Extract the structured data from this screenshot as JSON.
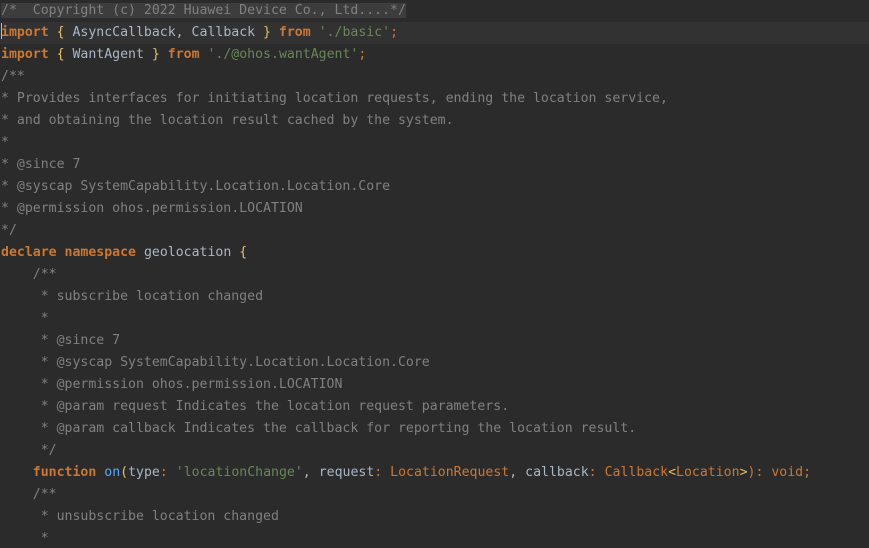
{
  "editor": {
    "header_comment": "/*  Copyright (c) 2022 Huawei Device Co., Ltd....*/",
    "imports": [
      {
        "kw": "import",
        "open": " { ",
        "names": "AsyncCallback, Callback",
        "close": " } ",
        "from": "from",
        "path": "'./basic'",
        "semi": ";"
      },
      {
        "kw": "import",
        "open": " { ",
        "names": "WantAgent",
        "close": " } ",
        "from": "from",
        "path": "'./@ohos.wantAgent'",
        "semi": ";"
      }
    ],
    "doc1": [
      "/**",
      "* Provides interfaces for initiating location requests, ending the location service,",
      "* and obtaining the location result cached by the system.",
      "*",
      "* @since 7",
      "* @syscap SystemCapability.Location.Location.Core",
      "* @permission ohos.permission.LOCATION",
      "*/"
    ],
    "declare": {
      "kw1": "declare",
      "kw2": "namespace",
      "name": "geolocation",
      "brace": "{"
    },
    "doc2": [
      "    /**",
      "     * subscribe location changed",
      "     *",
      "     * @since 7",
      "     * @syscap SystemCapability.Location.Location.Core",
      "     * @permission ohos.permission.LOCATION",
      "     * @param request Indicates the location request parameters.",
      "     * @param callback Indicates the callback for reporting the location result.",
      "     */"
    ],
    "func": {
      "indent": "    ",
      "kw": "function",
      "name": "on",
      "p_open": "(",
      "p1": "type",
      "colon1": ": ",
      "p1_val": "'locationChange'",
      "sep1": ", ",
      "p2": "request",
      "colon2": ": ",
      "p2_type": "LocationRequest",
      "sep2": ", ",
      "p3": "callback",
      "colon3": ": ",
      "p3_type": "Callback",
      "lt": "<",
      "p3_gen": "Location",
      "gt": ">",
      "p_close": "): ",
      "ret": "void",
      "semi": ";"
    },
    "doc3": [
      "    /**",
      "     * unsubscribe location changed",
      "     *"
    ]
  }
}
